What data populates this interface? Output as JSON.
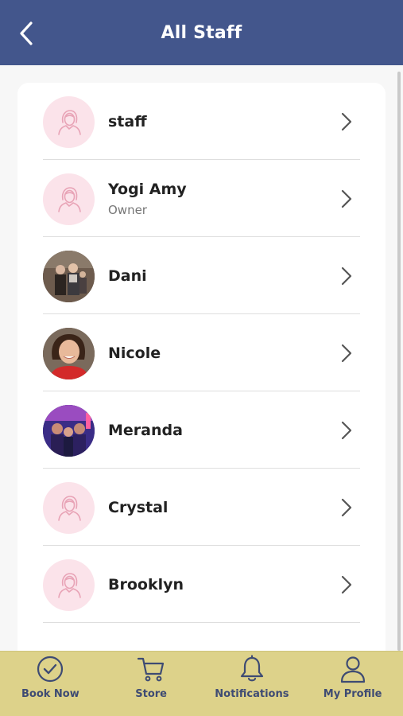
{
  "header": {
    "title": "All Staff",
    "back_icon": "chevron-left-icon"
  },
  "staff": [
    {
      "name": "staff",
      "role": "",
      "avatar": "placeholder-person-icon"
    },
    {
      "name": "Yogi Amy",
      "role": "Owner",
      "avatar": "placeholder-person-icon"
    },
    {
      "name": "Dani",
      "role": "",
      "avatar": "photo"
    },
    {
      "name": "Nicole",
      "role": "",
      "avatar": "photo"
    },
    {
      "name": "Meranda",
      "role": "",
      "avatar": "photo"
    },
    {
      "name": "Crystal",
      "role": "",
      "avatar": "placeholder-person-icon"
    },
    {
      "name": "Brooklyn",
      "role": "",
      "avatar": "placeholder-person-icon"
    }
  ],
  "tabs": [
    {
      "label": "Book Now",
      "icon": "check-circle-icon"
    },
    {
      "label": "Store",
      "icon": "cart-icon"
    },
    {
      "label": "Notifications",
      "icon": "bell-icon"
    },
    {
      "label": "My Profile",
      "icon": "user-icon"
    }
  ],
  "colors": {
    "header_bg": "#43568c",
    "tabbar_bg": "#ddd28a",
    "tab_text": "#3e4b73",
    "avatar_placeholder_bg": "#fbe3ea",
    "avatar_placeholder_stroke": "#e8a3b6"
  }
}
